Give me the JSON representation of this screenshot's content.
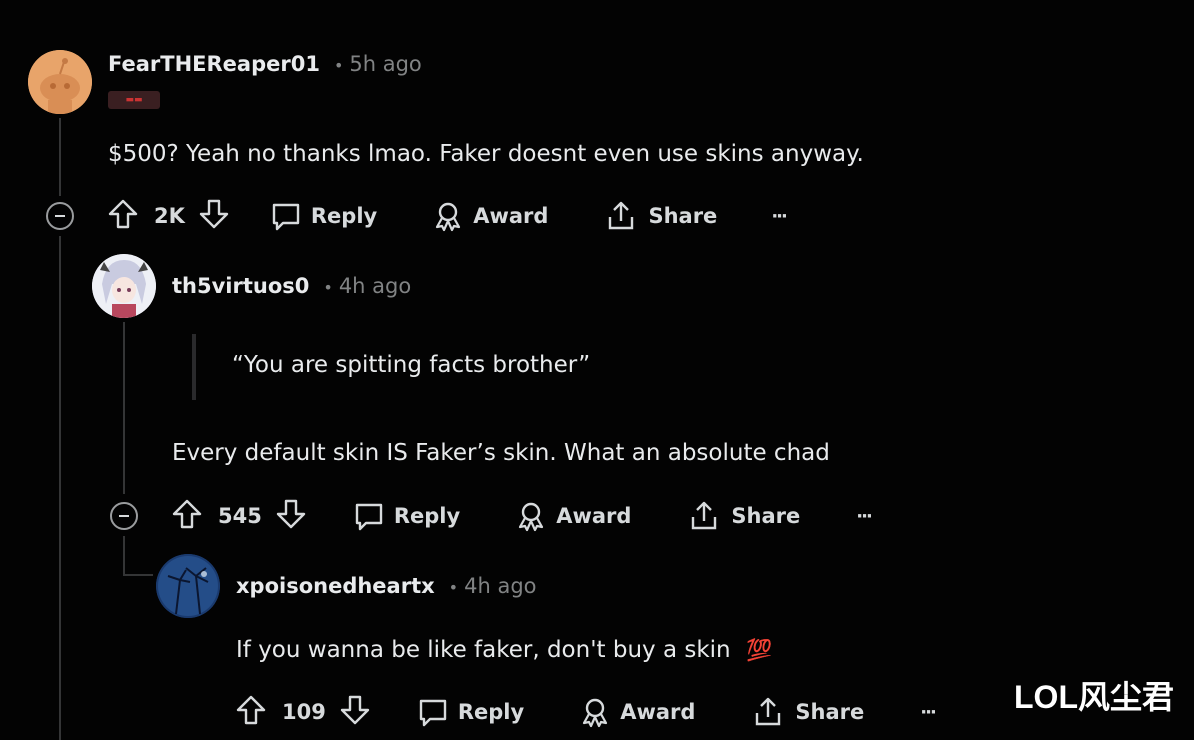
{
  "comments": [
    {
      "author": "FearTHEReaper01",
      "time": "5h ago",
      "separator": "•",
      "body": "$500? Yeah no thanks lmao. Faker doesnt even use skins anyway.",
      "votes": "2K",
      "reply_label": "Reply",
      "award_label": "Award",
      "share_label": "Share",
      "more_label": "···"
    },
    {
      "author": "th5virtuos0",
      "time": "4h ago",
      "separator": "•",
      "quote": "“You are spitting facts brother”",
      "body": "Every default skin IS Faker’s skin. What an absolute chad",
      "votes": "545",
      "reply_label": "Reply",
      "award_label": "Award",
      "share_label": "Share",
      "more_label": "···"
    },
    {
      "author": "xpoisonedheartx",
      "time": "4h ago",
      "separator": "•",
      "body": "If you wanna be like faker, don't buy a skin",
      "emoji": "💯",
      "votes": "109",
      "reply_label": "Reply",
      "award_label": "Award",
      "share_label": "Share",
      "more_label": "···"
    }
  ],
  "watermark": "LOL风尘君",
  "colors": {
    "background": "#030303",
    "text": "#d7dadc",
    "meta": "#818384",
    "line": "#343536"
  }
}
